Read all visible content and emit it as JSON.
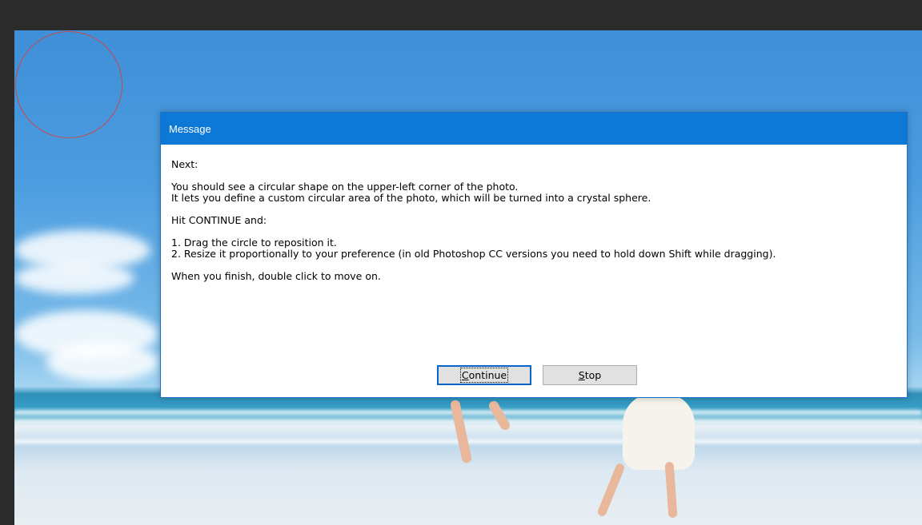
{
  "dialog": {
    "title": "Message",
    "lines": [
      "Next:",
      "",
      "You should see a circular shape on the upper-left corner of the photo.",
      "It lets you define a custom circular area of the photo, which will be turned into a crystal sphere.",
      "",
      "Hit CONTINUE and:",
      "",
      "1. Drag the circle to reposition it.",
      "2. Resize it proportionally to your preference (in old Photoshop CC versions you need to hold down Shift while dragging).",
      "",
      "When you finish, double click to move on."
    ],
    "buttons": {
      "continue_mnemonic": "C",
      "continue_rest": "ontinue",
      "stop_mnemonic": "S",
      "stop_rest": "top"
    }
  },
  "colors": {
    "titlebar": "#0d78d6",
    "selection_circle": "#c9484a",
    "workspace": "#2b2b2b"
  }
}
